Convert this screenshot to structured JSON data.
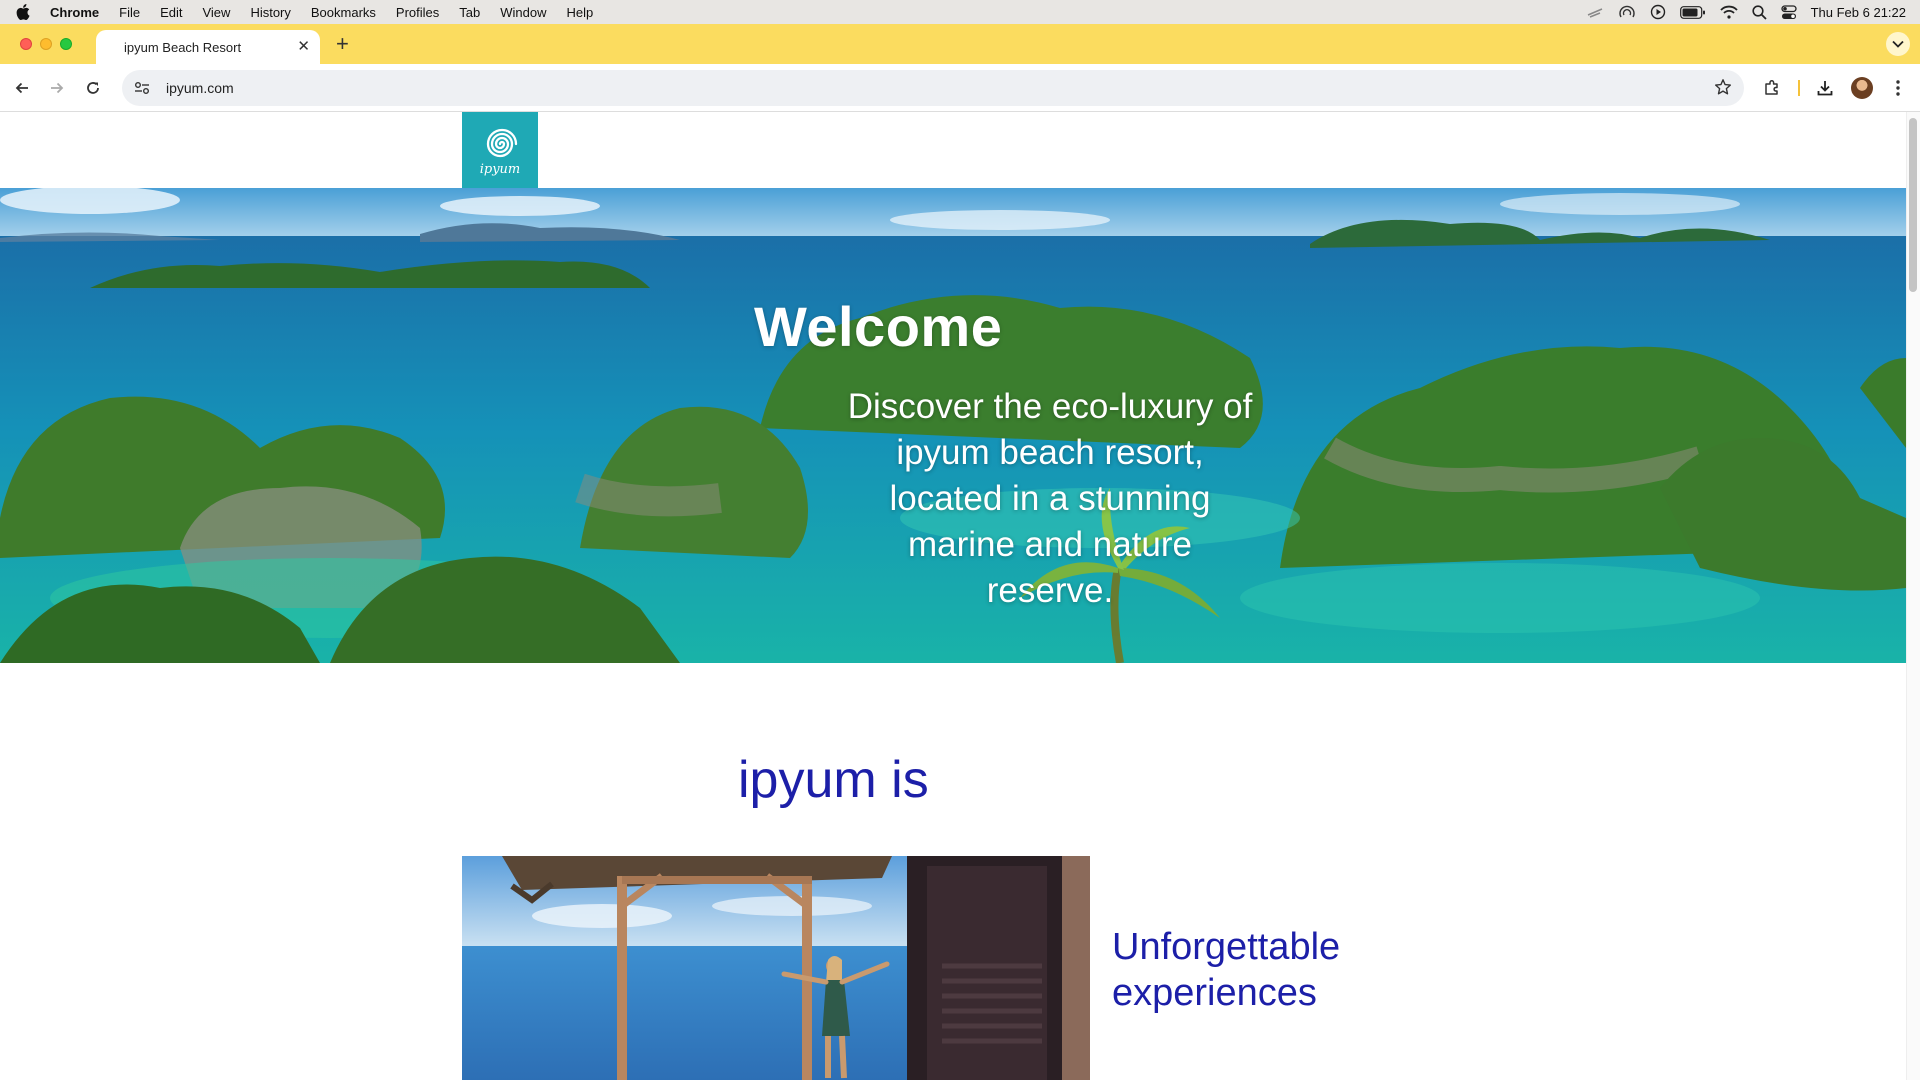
{
  "menubar": {
    "app_name": "Chrome",
    "items": [
      "File",
      "Edit",
      "View",
      "History",
      "Bookmarks",
      "Profiles",
      "Tab",
      "Window",
      "Help"
    ],
    "clock": "Thu Feb 6  21:22"
  },
  "browser": {
    "tab_title": "ipyum Beach Resort",
    "url": "ipyum.com"
  },
  "page": {
    "logo_text": "ipyum",
    "hero_title": "Welcome",
    "hero_text": "Discover the eco-luxury of ipyum beach resort, located in a stunning marine and nature reserve.",
    "section_heading": "ipyum is",
    "feature_text": "Unforgettable experiences"
  },
  "colors": {
    "tab_strip": "#fbdc5f",
    "logo_bg": "#1fa9b5",
    "heading_blue": "#1c1fa8"
  },
  "icons": [
    "apple-icon",
    "close-icon",
    "plus-icon",
    "back-icon",
    "forward-icon",
    "reload-icon",
    "site-info-icon",
    "star-icon",
    "extensions-icon",
    "download-icon",
    "menu-icon",
    "wifi-icon",
    "search-icon",
    "battery-icon",
    "control-center-icon",
    "chevron-down-icon"
  ]
}
